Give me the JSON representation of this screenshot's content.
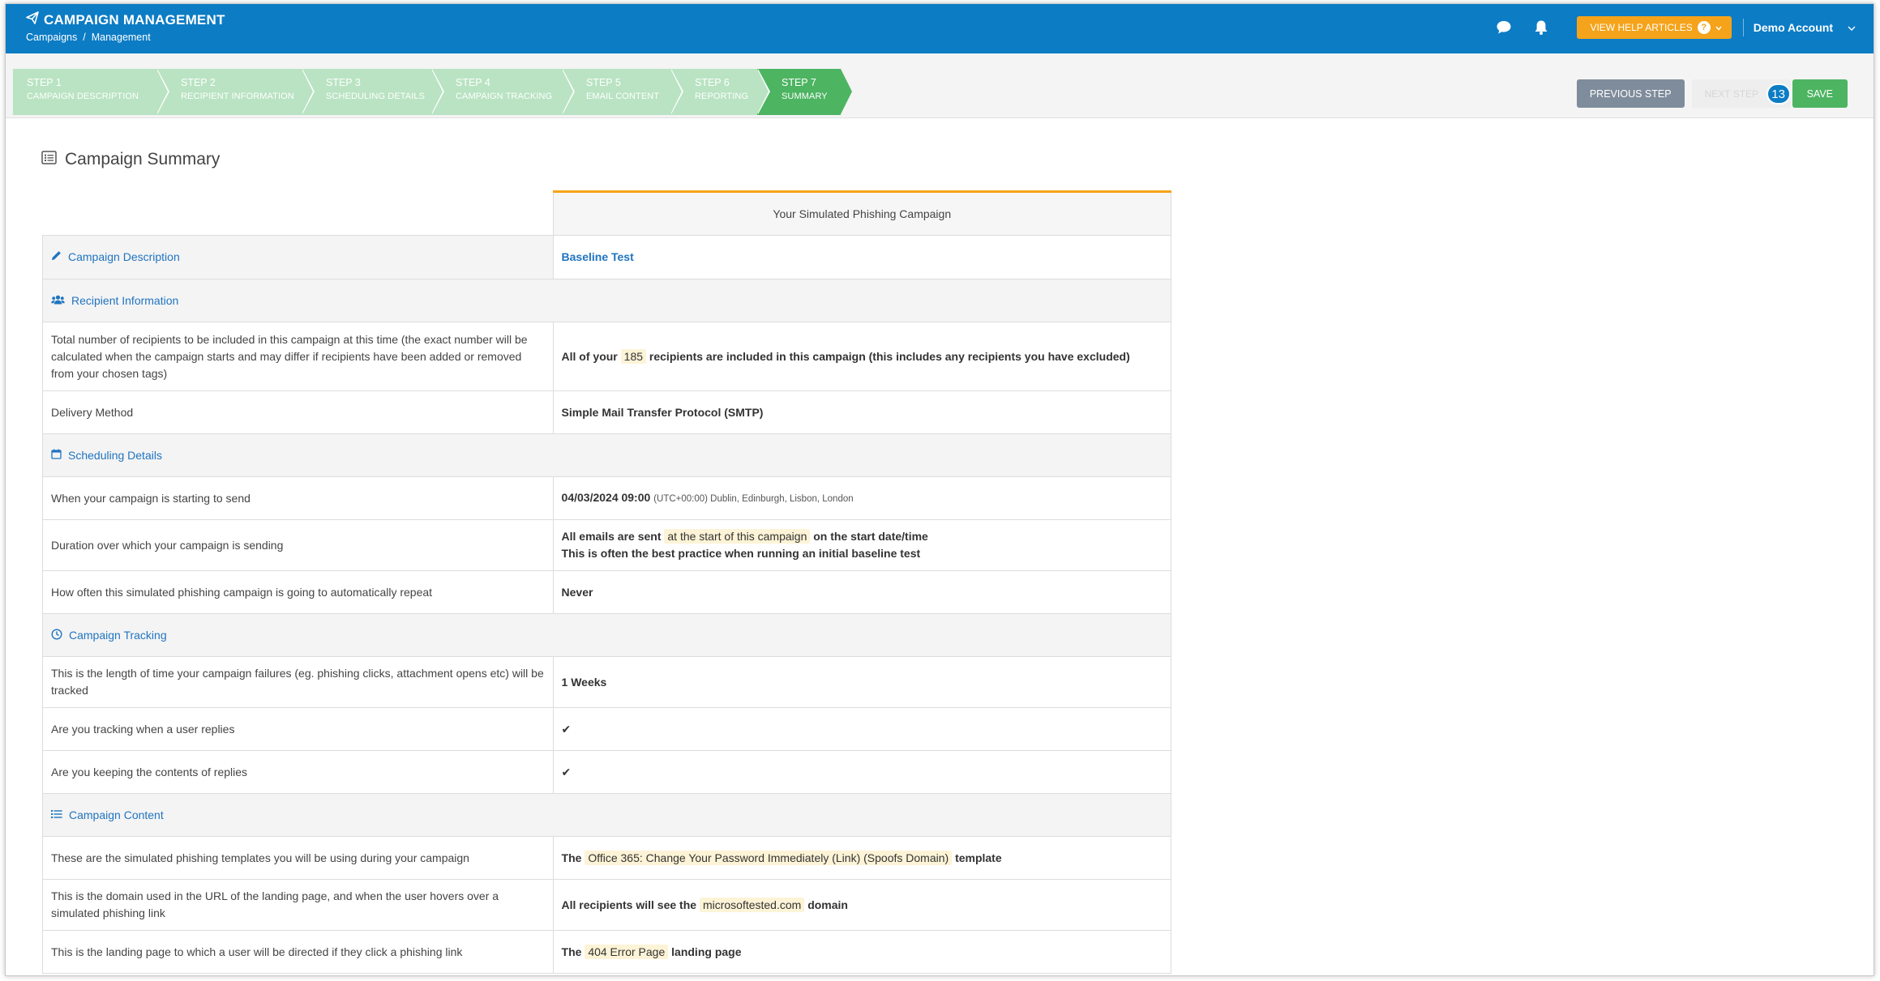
{
  "header": {
    "title": "CAMPAIGN MANAGEMENT",
    "breadcrumb": [
      "Campaigns",
      "/",
      "Management"
    ],
    "help_button": "VIEW HELP ARTICLES",
    "help_icon": "?",
    "account": "Demo Account",
    "icons": [
      "chat-icon",
      "bell-icon",
      "chevron-down-icon"
    ]
  },
  "wizard": {
    "steps": [
      {
        "num": "STEP 1",
        "label": "CAMPAIGN DESCRIPTION"
      },
      {
        "num": "STEP 2",
        "label": "RECIPIENT INFORMATION"
      },
      {
        "num": "STEP 3",
        "label": "SCHEDULING DETAILS"
      },
      {
        "num": "STEP 4",
        "label": "CAMPAIGN TRACKING"
      },
      {
        "num": "STEP 5",
        "label": "EMAIL CONTENT"
      },
      {
        "num": "STEP 6",
        "label": "REPORTING"
      },
      {
        "num": "STEP 7",
        "label": "SUMMARY"
      }
    ],
    "active_step": 7,
    "prev_label": "PREVIOUS STEP",
    "next_label": "NEXT STEP",
    "badge": "13",
    "save_label": "SAVE"
  },
  "summary": {
    "title": "Campaign Summary",
    "column_header": "Your Simulated Phishing Campaign",
    "sections": {
      "description": "Campaign Description",
      "recipients": "Recipient Information",
      "scheduling": "Scheduling Details",
      "tracking": "Campaign Tracking",
      "content": "Campaign Content"
    },
    "description_value": "Baseline Test",
    "recipients_label": "Total number of recipients to be included in this campaign at this time (the exact number will be calculated when the campaign starts and may differ if recipients have been added or removed from your chosen tags)",
    "recipients_pre": "All of your",
    "recipients_count": "185",
    "recipients_post": "recipients are included in this campaign (this includes any recipients you have excluded)",
    "delivery_label": "Delivery Method",
    "delivery_value": "Simple Mail Transfer Protocol (SMTP)",
    "start_label": "When your campaign is starting to send",
    "start_value": "04/03/2024 09:00",
    "start_tz": "(UTC+00:00) Dublin, Edinburgh, Lisbon, London",
    "duration_label": "Duration over which your campaign is sending",
    "duration_pre": "All emails are sent",
    "duration_hl": "at the start of this campaign",
    "duration_post": "on the start date/time",
    "duration_line2": "This is often the best practice when running an initial baseline test",
    "repeat_label": "How often this simulated phishing campaign is going to automatically repeat",
    "repeat_value": "Never",
    "tracklen_label": "This is the length of time your campaign failures (eg. phishing clicks, attachment opens etc) will be tracked",
    "tracklen_value": "1 Weeks",
    "replies_label": "Are you tracking when a user replies",
    "replies_value": "✔",
    "keep_label": "Are you keeping the contents of replies",
    "keep_value": "✔",
    "templates_label": "These are the simulated phishing templates you will be using during your campaign",
    "templates_pre": "The",
    "templates_hl": "Office 365: Change Your Password Immediately (Link) (Spoofs Domain)",
    "templates_post": "template",
    "domain_label": "This is the domain used in the URL of the landing page, and when the user hovers over a simulated phishing link",
    "domain_pre": "All recipients will see the",
    "domain_hl": "microsoftested.com",
    "domain_post": "domain",
    "landing_label": "This is the landing page to which a user will be directed if they click a phishing link",
    "landing_pre": "The",
    "landing_hl": "404 Error Page",
    "landing_post": "landing page"
  },
  "colors": {
    "header_blue": "#0c7cc5",
    "help_orange": "#f5a31a",
    "step_green": "#4db462",
    "step_green_light": "#b9e3c2",
    "section_link": "#1f74c1"
  }
}
